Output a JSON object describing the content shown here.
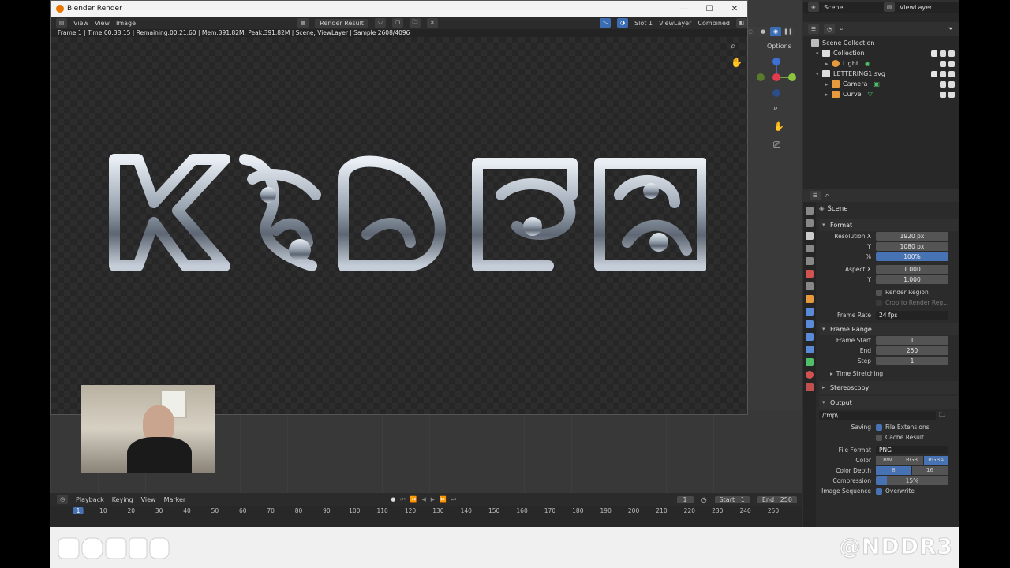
{
  "render_window": {
    "title": "Blender Render",
    "menu": [
      "View",
      "View",
      "Image"
    ],
    "image_name": "Render Result",
    "slot": "Slot 1",
    "view_layer": "ViewLayer",
    "pass": "Combined",
    "status": "Frame:1 | Time:00:38.15 | Remaining:00:21.60 | Mem:391.82M, Peak:391.82M | Scene, ViewLayer | Sample 2608/4096"
  },
  "top_bar": {
    "scene": "Scene",
    "view_layer": "ViewLayer"
  },
  "viewport": {
    "options_label": "Options"
  },
  "outliner": {
    "items": [
      {
        "label": "Scene Collection",
        "depth": 0
      },
      {
        "label": "Collection",
        "depth": 1
      },
      {
        "label": "Light",
        "depth": 2
      },
      {
        "label": "LETTERING1.svg",
        "depth": 1
      },
      {
        "label": "Camera",
        "depth": 2
      },
      {
        "label": "Curve",
        "depth": 2
      }
    ]
  },
  "properties": {
    "context": "Scene",
    "format_label": "Format",
    "resolution_x_label": "Resolution X",
    "resolution_x": "1920 px",
    "resolution_y_label": "Y",
    "resolution_y": "1080 px",
    "percent_label": "%",
    "percent": "100%",
    "aspect_x_label": "Aspect X",
    "aspect_x": "1.000",
    "aspect_y_label": "Y",
    "aspect_y": "1.000",
    "render_region": "Render Region",
    "crop_region": "Crop to Render Reg...",
    "frame_rate_label": "Frame Rate",
    "frame_rate": "24 fps",
    "frame_range_label": "Frame Range",
    "frame_start_label": "Frame Start",
    "frame_start": "1",
    "end_label": "End",
    "end": "250",
    "step_label": "Step",
    "step": "1",
    "time_stretching": "Time Stretching",
    "stereoscopy": "Stereoscopy",
    "output_label": "Output",
    "output_path": "/tmp\\",
    "saving_label": "Saving",
    "file_extensions": "File Extensions",
    "cache_result": "Cache Result",
    "file_format_label": "File Format",
    "file_format": "PNG",
    "color_label": "Color",
    "color_options": [
      "BW",
      "RGB",
      "RGBA"
    ],
    "color_depth_label": "Color Depth",
    "color_depth_options": [
      "8",
      "16"
    ],
    "compression_label": "Compression",
    "compression": "15%",
    "compression_fraction": 0.15,
    "image_sequence_label": "Image Sequence",
    "overwrite": "Overwrite"
  },
  "timeline": {
    "menu": [
      "Playback",
      "Keying",
      "View",
      "Marker"
    ],
    "current_frame": "1",
    "start_label": "Start",
    "start": "1",
    "end_label": "End",
    "end": "250",
    "ruler": [
      "1",
      "10",
      "20",
      "30",
      "40",
      "50",
      "60",
      "70",
      "80",
      "90",
      "100",
      "110",
      "120",
      "130",
      "140",
      "150",
      "160",
      "170",
      "180",
      "190",
      "200",
      "210",
      "220",
      "230",
      "240",
      "250"
    ]
  },
  "watermark": {
    "handle": "@NDDR3"
  },
  "colors": {
    "accent": "#4772b3",
    "blender_orange": "#ea7600",
    "background": "#303030"
  }
}
